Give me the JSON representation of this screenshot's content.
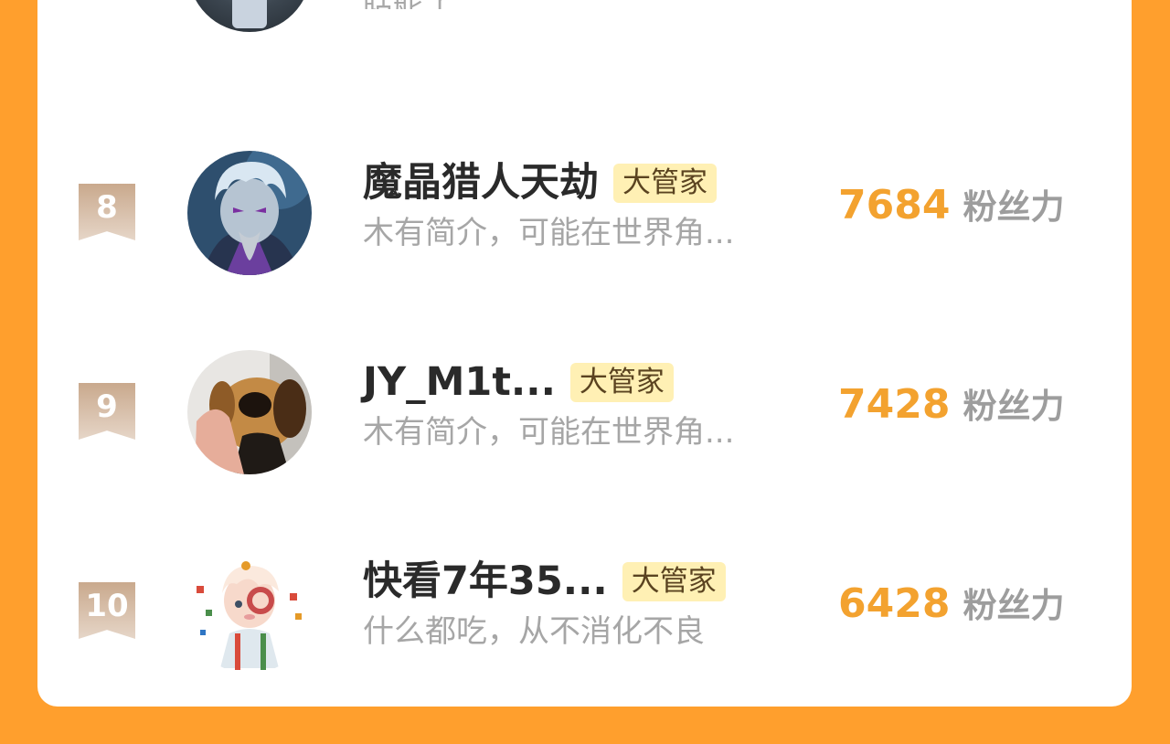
{
  "partial_row": {
    "bio": "聒舵了"
  },
  "badge_color": "#fff0b4",
  "accent_color": "#f3a22f",
  "rows": [
    {
      "rank": "8",
      "name": "魔晶猎人天劫",
      "badge": "大管家",
      "bio": "木有简介，可能在世界角...",
      "score": "7684",
      "score_label": "粉丝力",
      "avatar_icon": "anime-wizard-avatar"
    },
    {
      "rank": "9",
      "name": "JY_M1t...",
      "badge": "大管家",
      "bio": "木有简介，可能在世界角...",
      "score": "7428",
      "score_label": "粉丝力",
      "avatar_icon": "dog-photo-avatar"
    },
    {
      "rank": "10",
      "name": "快看7年35...",
      "badge": "大管家",
      "bio": "什么都吃，从不消化不良",
      "score": "6428",
      "score_label": "粉丝力",
      "avatar_icon": "cartoon-character-avatar"
    }
  ]
}
